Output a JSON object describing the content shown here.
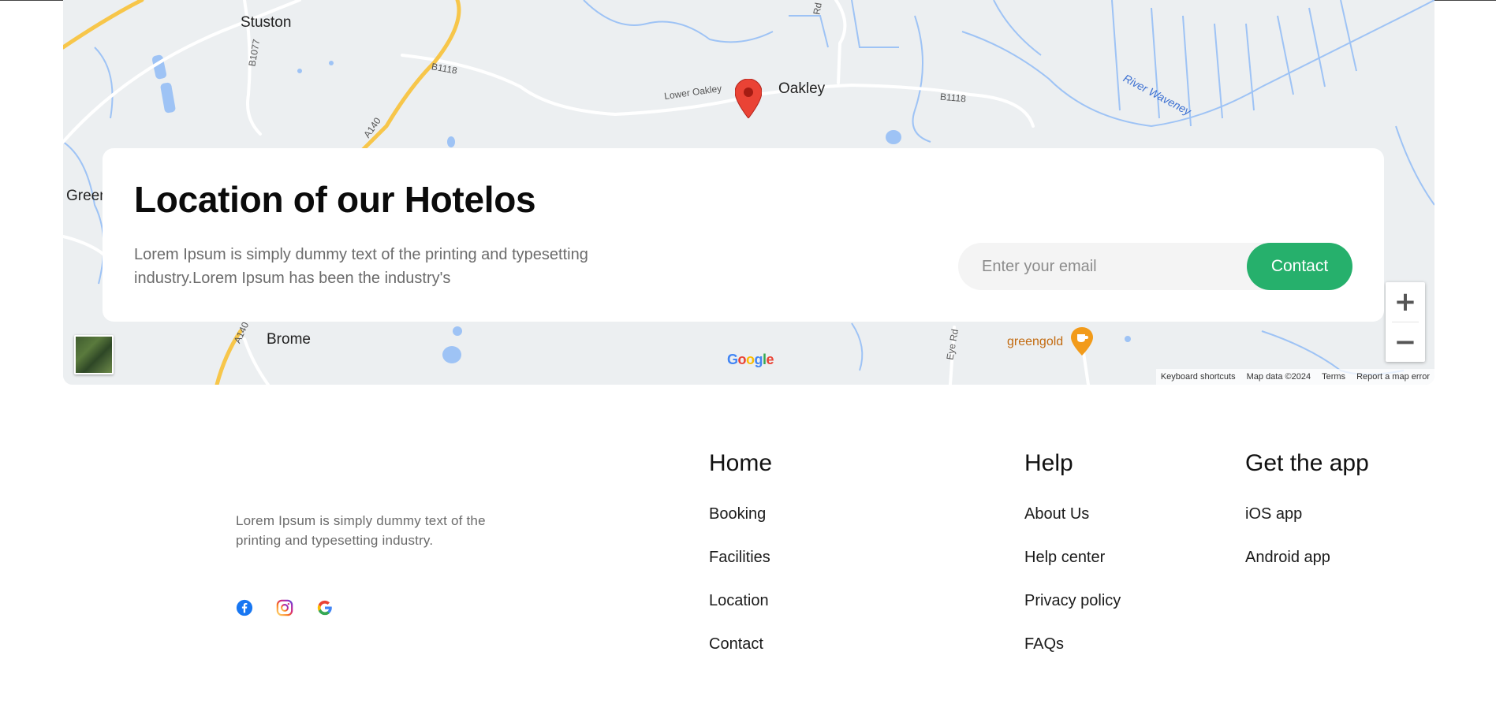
{
  "map": {
    "places": {
      "stuston": "Stuston",
      "oakley": "Oakley",
      "green": "Green",
      "brome": "Brome"
    },
    "roads": {
      "b1118_west": "B1118",
      "b1118_east": "B1118",
      "b1077": "B1077",
      "a140_north": "A140",
      "a140_south": "A140",
      "lower_oakley": "Lower Oakley",
      "eye_rd": "Eye Rd",
      "rd_top": "Rd"
    },
    "river": "River Waveney",
    "poi": "greengold",
    "google_logo": [
      "G",
      "o",
      "o",
      "g",
      "l",
      "e"
    ],
    "attribution": {
      "shortcuts": "Keyboard shortcuts",
      "map_data": "Map data ©2024",
      "terms": "Terms",
      "report": "Report a map error"
    },
    "zoom_in": "+",
    "zoom_out": "−",
    "colors": {
      "background": "#eceff1",
      "water": "#9ec3f5",
      "major_road": "#f7c64a",
      "pin": "#ea4335"
    }
  },
  "card": {
    "title": "Location of our Hotelos",
    "description": "Lorem Ipsum is simply dummy text of the printing and typesetting industry.Lorem Ipsum has been the industry's",
    "email_placeholder": "Enter your email",
    "contact_label": "Contact",
    "accent_color": "#26b06c"
  },
  "footer": {
    "description": "Lorem Ipsum is simply dummy text of the printing and typesetting industry.",
    "socials": [
      "facebook-icon",
      "instagram-icon",
      "google-icon"
    ],
    "columns": [
      {
        "title": "Home",
        "links": [
          "Booking",
          "Facilities",
          "Location",
          "Contact"
        ]
      },
      {
        "title": "Help",
        "links": [
          "About Us",
          "Help center",
          "Privacy policy",
          "FAQs"
        ]
      },
      {
        "title": "Get the app",
        "links": [
          "iOS app",
          "Android app"
        ]
      }
    ]
  }
}
